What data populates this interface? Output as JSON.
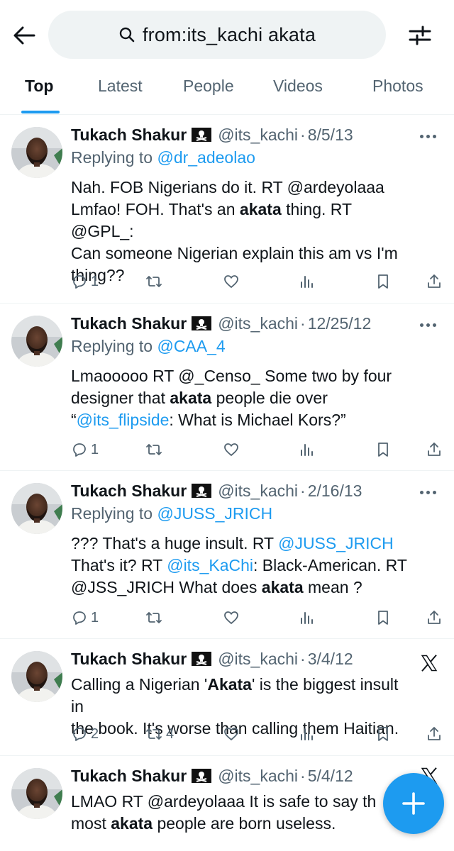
{
  "search": {
    "query": "from:its_kachi akata"
  },
  "tabs": [
    {
      "label": "Top"
    },
    {
      "label": "Latest"
    },
    {
      "label": "People"
    },
    {
      "label": "Videos"
    },
    {
      "label": "Photos"
    }
  ],
  "colors": {
    "accent": "#1d9bf0",
    "text": "#0f1419",
    "muted": "#536471"
  },
  "tweets": [
    {
      "name": "Tukach Shakur",
      "handle": "@its_kachi",
      "dot": "·",
      "date": "8/5/13",
      "reply_prefix": "Replying to",
      "reply_to": "@dr_adeolao",
      "body": {
        "l1": "Nah. FOB Nigerians do it. RT @ardeyolaaa",
        "l2a": "Lmfao! FOH. That's an ",
        "l2b": "akata",
        "l2c": " thing. RT @GPL_:",
        "l3": "Can someone Nigerian explain this am vs I'm",
        "l4": "thing??"
      },
      "reply_count": "1",
      "retweet_count": "",
      "corner_icon": "more-icon"
    },
    {
      "name": "Tukach Shakur",
      "handle": "@its_kachi",
      "dot": "·",
      "date": "12/25/12",
      "reply_prefix": "Replying to",
      "reply_to": "@CAA_4",
      "body": {
        "l1": "Lmaooooo RT @_Censo_ Some two by four",
        "l2a": "designer that ",
        "l2b": "akata",
        "l2c": " people die over",
        "l3a": "“",
        "l3b": "@its_flipside",
        "l3c": ": What is Michael Kors?”"
      },
      "reply_count": "1",
      "retweet_count": "",
      "corner_icon": "more-icon"
    },
    {
      "name": "Tukach Shakur",
      "handle": "@its_kachi",
      "dot": "·",
      "date": "2/16/13",
      "reply_prefix": "Replying to",
      "reply_to": "@JUSS_JRICH",
      "body": {
        "l1a": "??? That's a huge insult. RT ",
        "l1b": "@JUSS_JRICH",
        "l2a": "That's it?  RT ",
        "l2b": "@its_KaChi",
        "l2c": ": Black-American. RT",
        "l3a": "@JSS_JRICH What does ",
        "l3b": "akata",
        "l3c": " mean ?"
      },
      "reply_count": "1",
      "retweet_count": "",
      "corner_icon": "more-icon"
    },
    {
      "name": "Tukach Shakur",
      "handle": "@its_kachi",
      "dot": "·",
      "date": "3/4/12",
      "body": {
        "l1a": "Calling a Nigerian '",
        "l1b": "Akata",
        "l1c": "' is the biggest insult in",
        "l2": "the book. It's worse than calling them Haitian."
      },
      "reply_count": "2",
      "retweet_count": "4",
      "corner_icon": "x-logo-icon"
    },
    {
      "name": "Tukach Shakur",
      "handle": "@its_kachi",
      "dot": "·",
      "date": "5/4/12",
      "body": {
        "l1": "LMAO RT @ardeyolaaa It is safe to say th",
        "l2a": "most ",
        "l2b": "akata",
        "l2c": " people are born useless."
      },
      "corner_icon": "x-logo-icon"
    }
  ]
}
